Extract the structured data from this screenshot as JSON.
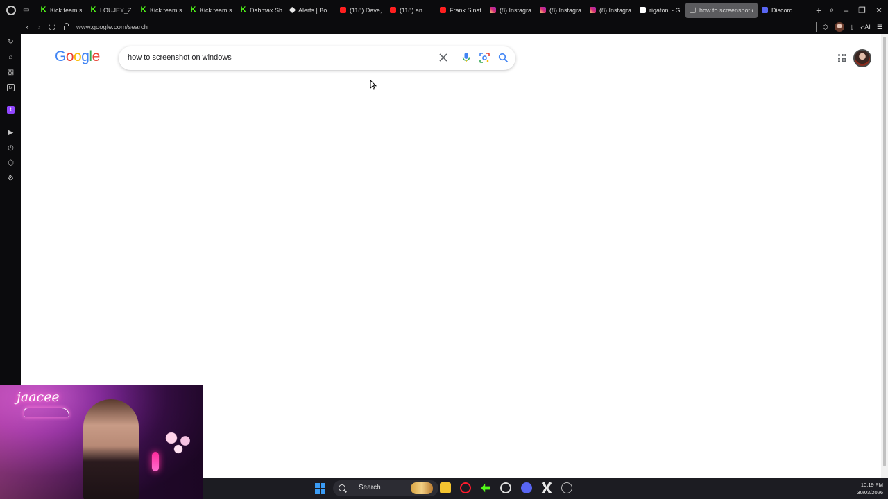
{
  "browser": {
    "tabs": [
      {
        "title": "Kick team s",
        "icon": "kick-icon"
      },
      {
        "title": "LOUJEY_Z",
        "icon": "kick-icon"
      },
      {
        "title": "Kick team s",
        "icon": "kick-icon"
      },
      {
        "title": "Kick team s",
        "icon": "kick-icon"
      },
      {
        "title": "Dahmax Sh",
        "icon": "kick-icon"
      },
      {
        "title": "Alerts | Bo",
        "icon": "alert-icon"
      },
      {
        "title": "(118) Dave,",
        "icon": "youtube-icon"
      },
      {
        "title": "(118) an",
        "icon": "youtube-icon"
      },
      {
        "title": "Frank Sinat",
        "icon": "youtube-icon"
      },
      {
        "title": "(8) Instagra",
        "icon": "instagram-icon"
      },
      {
        "title": "(8) Instagra",
        "icon": "instagram-icon"
      },
      {
        "title": "(8) Instagra",
        "icon": "instagram-icon"
      },
      {
        "title": "rigatoni - G",
        "icon": "google-icon"
      },
      {
        "title": "how to screenshot o",
        "icon": "loading-icon",
        "active": true
      },
      {
        "title": "Discord",
        "icon": "discord-icon"
      }
    ],
    "new_tab_symbol": "+",
    "url": "www.google.com/search",
    "ai_label": "AI"
  },
  "google": {
    "logo_letters": [
      {
        "ch": "G",
        "color": "#4285F4"
      },
      {
        "ch": "o",
        "color": "#EA4335"
      },
      {
        "ch": "o",
        "color": "#FBBC05"
      },
      {
        "ch": "g",
        "color": "#4285F4"
      },
      {
        "ch": "l",
        "color": "#34A853"
      },
      {
        "ch": "e",
        "color": "#EA4335"
      }
    ],
    "query": "how to screenshot on windows"
  },
  "webcam": {
    "streamer_name": "jaacee"
  },
  "taskbar": {
    "search_label": "Search",
    "time": "10:19 PM",
    "date": "30/03/2026"
  },
  "colors": {
    "browser_chrome": "#0b0b0d",
    "active_tab": "#5b5b5e",
    "kick_green": "#53fc18",
    "taskbar": "#1c1c22",
    "windows_blue": "#3b9cf5"
  }
}
